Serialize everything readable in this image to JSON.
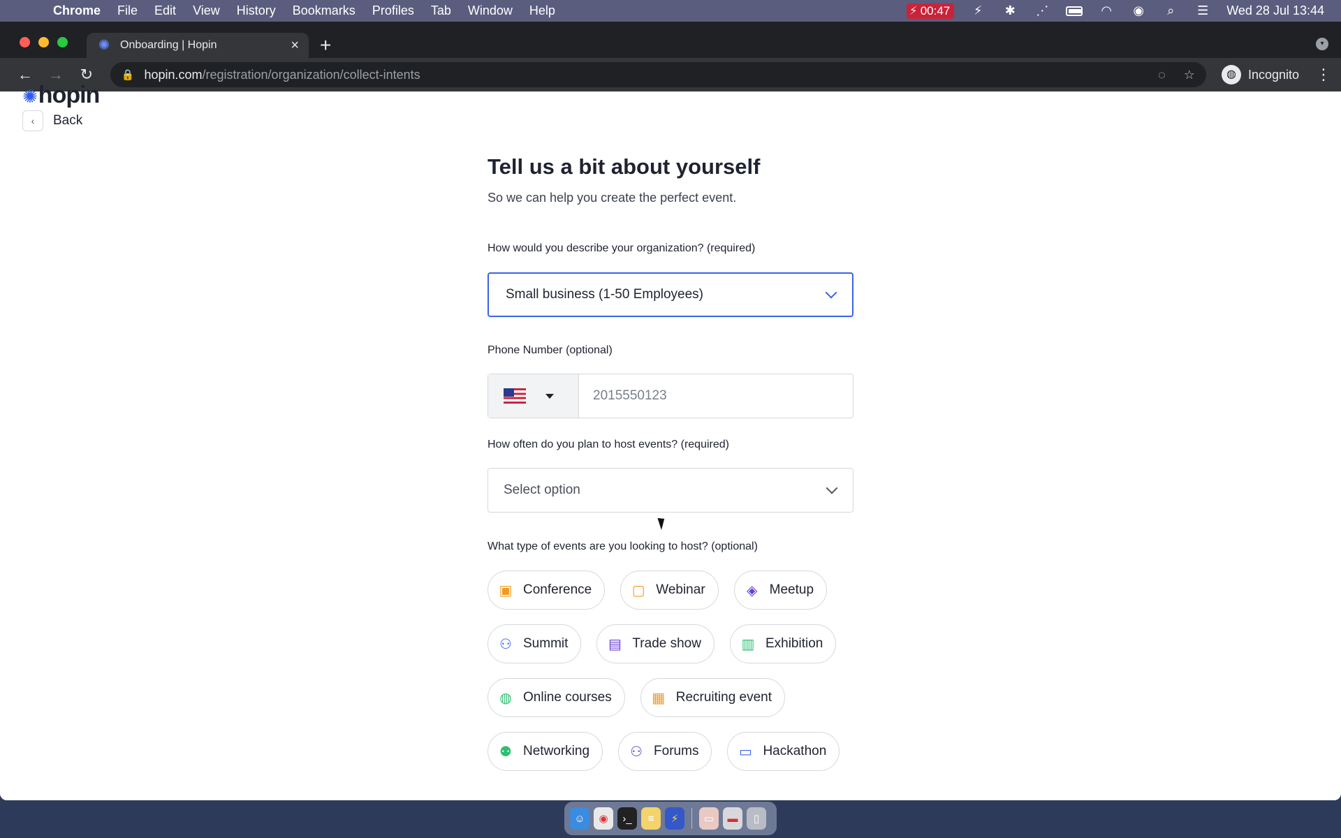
{
  "menubar": {
    "apple_icon": "apple-icon",
    "app_name": "Chrome",
    "menus": [
      "File",
      "Edit",
      "View",
      "History",
      "Bookmarks",
      "Profiles",
      "Tab",
      "Window",
      "Help"
    ],
    "recording_time": "00:47",
    "clock": "Wed 28 Jul  13:44"
  },
  "browser": {
    "tab_title": "Onboarding | Hopin",
    "url_host": "hopin.com",
    "url_path": "/registration/organization/collect-intents",
    "profile_label": "Incognito"
  },
  "page": {
    "logo_text": "hopin",
    "back_label": "Back",
    "heading": "Tell us a bit about yourself",
    "subheading": "So we can help you create the perfect event.",
    "org_label": "How would you describe your organization? (required)",
    "org_value": "Small business (1-50 Employees)",
    "phone_label": "Phone Number (optional)",
    "phone_country": "US",
    "phone_placeholder": "2015550123",
    "frequency_label": "How often do you plan to host events? (required)",
    "frequency_value": "Select option",
    "event_types_label": "What type of events are you looking to host? (optional)",
    "event_types": [
      {
        "label": "Conference",
        "icon": "conference-icon",
        "color": "#f29a1f"
      },
      {
        "label": "Webinar",
        "icon": "webinar-icon",
        "color": "#f29a1f"
      },
      {
        "label": "Meetup",
        "icon": "meetup-icon",
        "color": "#6a3fd6"
      },
      {
        "label": "Summit",
        "icon": "summit-icon",
        "color": "#3a63e8"
      },
      {
        "label": "Trade show",
        "icon": "trade-show-icon",
        "color": "#6a3fd6"
      },
      {
        "label": "Exhibition",
        "icon": "exhibition-icon",
        "color": "#2fbf71"
      },
      {
        "label": "Online courses",
        "icon": "online-courses-icon",
        "color": "#2fbf71"
      },
      {
        "label": "Recruiting event",
        "icon": "recruiting-event-icon",
        "color": "#f29a1f"
      },
      {
        "label": "Networking",
        "icon": "networking-icon",
        "color": "#2fbf71"
      },
      {
        "label": "Forums",
        "icon": "forums-icon",
        "color": "#6a3fd6"
      },
      {
        "label": "Hackathon",
        "icon": "hackathon-icon",
        "color": "#3a63e8"
      }
    ]
  },
  "colors": {
    "accent": "#3a63e8",
    "menubar": "#5a5d7e",
    "chrome_dark": "#202124"
  }
}
